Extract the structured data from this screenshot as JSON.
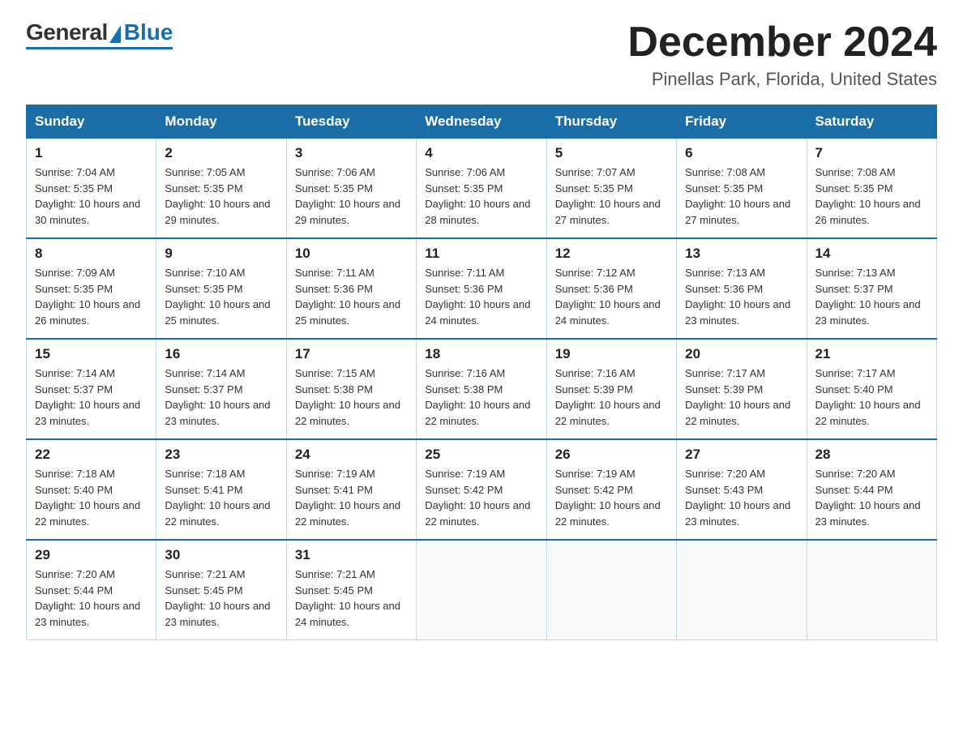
{
  "header": {
    "logo_general": "General",
    "logo_blue": "Blue",
    "month_title": "December 2024",
    "location": "Pinellas Park, Florida, United States"
  },
  "weekdays": [
    "Sunday",
    "Monday",
    "Tuesday",
    "Wednesday",
    "Thursday",
    "Friday",
    "Saturday"
  ],
  "weeks": [
    [
      {
        "day": "1",
        "sunrise": "7:04 AM",
        "sunset": "5:35 PM",
        "daylight": "10 hours and 30 minutes."
      },
      {
        "day": "2",
        "sunrise": "7:05 AM",
        "sunset": "5:35 PM",
        "daylight": "10 hours and 29 minutes."
      },
      {
        "day": "3",
        "sunrise": "7:06 AM",
        "sunset": "5:35 PM",
        "daylight": "10 hours and 29 minutes."
      },
      {
        "day": "4",
        "sunrise": "7:06 AM",
        "sunset": "5:35 PM",
        "daylight": "10 hours and 28 minutes."
      },
      {
        "day": "5",
        "sunrise": "7:07 AM",
        "sunset": "5:35 PM",
        "daylight": "10 hours and 27 minutes."
      },
      {
        "day": "6",
        "sunrise": "7:08 AM",
        "sunset": "5:35 PM",
        "daylight": "10 hours and 27 minutes."
      },
      {
        "day": "7",
        "sunrise": "7:08 AM",
        "sunset": "5:35 PM",
        "daylight": "10 hours and 26 minutes."
      }
    ],
    [
      {
        "day": "8",
        "sunrise": "7:09 AM",
        "sunset": "5:35 PM",
        "daylight": "10 hours and 26 minutes."
      },
      {
        "day": "9",
        "sunrise": "7:10 AM",
        "sunset": "5:35 PM",
        "daylight": "10 hours and 25 minutes."
      },
      {
        "day": "10",
        "sunrise": "7:11 AM",
        "sunset": "5:36 PM",
        "daylight": "10 hours and 25 minutes."
      },
      {
        "day": "11",
        "sunrise": "7:11 AM",
        "sunset": "5:36 PM",
        "daylight": "10 hours and 24 minutes."
      },
      {
        "day": "12",
        "sunrise": "7:12 AM",
        "sunset": "5:36 PM",
        "daylight": "10 hours and 24 minutes."
      },
      {
        "day": "13",
        "sunrise": "7:13 AM",
        "sunset": "5:36 PM",
        "daylight": "10 hours and 23 minutes."
      },
      {
        "day": "14",
        "sunrise": "7:13 AM",
        "sunset": "5:37 PM",
        "daylight": "10 hours and 23 minutes."
      }
    ],
    [
      {
        "day": "15",
        "sunrise": "7:14 AM",
        "sunset": "5:37 PM",
        "daylight": "10 hours and 23 minutes."
      },
      {
        "day": "16",
        "sunrise": "7:14 AM",
        "sunset": "5:37 PM",
        "daylight": "10 hours and 23 minutes."
      },
      {
        "day": "17",
        "sunrise": "7:15 AM",
        "sunset": "5:38 PM",
        "daylight": "10 hours and 22 minutes."
      },
      {
        "day": "18",
        "sunrise": "7:16 AM",
        "sunset": "5:38 PM",
        "daylight": "10 hours and 22 minutes."
      },
      {
        "day": "19",
        "sunrise": "7:16 AM",
        "sunset": "5:39 PM",
        "daylight": "10 hours and 22 minutes."
      },
      {
        "day": "20",
        "sunrise": "7:17 AM",
        "sunset": "5:39 PM",
        "daylight": "10 hours and 22 minutes."
      },
      {
        "day": "21",
        "sunrise": "7:17 AM",
        "sunset": "5:40 PM",
        "daylight": "10 hours and 22 minutes."
      }
    ],
    [
      {
        "day": "22",
        "sunrise": "7:18 AM",
        "sunset": "5:40 PM",
        "daylight": "10 hours and 22 minutes."
      },
      {
        "day": "23",
        "sunrise": "7:18 AM",
        "sunset": "5:41 PM",
        "daylight": "10 hours and 22 minutes."
      },
      {
        "day": "24",
        "sunrise": "7:19 AM",
        "sunset": "5:41 PM",
        "daylight": "10 hours and 22 minutes."
      },
      {
        "day": "25",
        "sunrise": "7:19 AM",
        "sunset": "5:42 PM",
        "daylight": "10 hours and 22 minutes."
      },
      {
        "day": "26",
        "sunrise": "7:19 AM",
        "sunset": "5:42 PM",
        "daylight": "10 hours and 22 minutes."
      },
      {
        "day": "27",
        "sunrise": "7:20 AM",
        "sunset": "5:43 PM",
        "daylight": "10 hours and 23 minutes."
      },
      {
        "day": "28",
        "sunrise": "7:20 AM",
        "sunset": "5:44 PM",
        "daylight": "10 hours and 23 minutes."
      }
    ],
    [
      {
        "day": "29",
        "sunrise": "7:20 AM",
        "sunset": "5:44 PM",
        "daylight": "10 hours and 23 minutes."
      },
      {
        "day": "30",
        "sunrise": "7:21 AM",
        "sunset": "5:45 PM",
        "daylight": "10 hours and 23 minutes."
      },
      {
        "day": "31",
        "sunrise": "7:21 AM",
        "sunset": "5:45 PM",
        "daylight": "10 hours and 24 minutes."
      },
      null,
      null,
      null,
      null
    ]
  ]
}
